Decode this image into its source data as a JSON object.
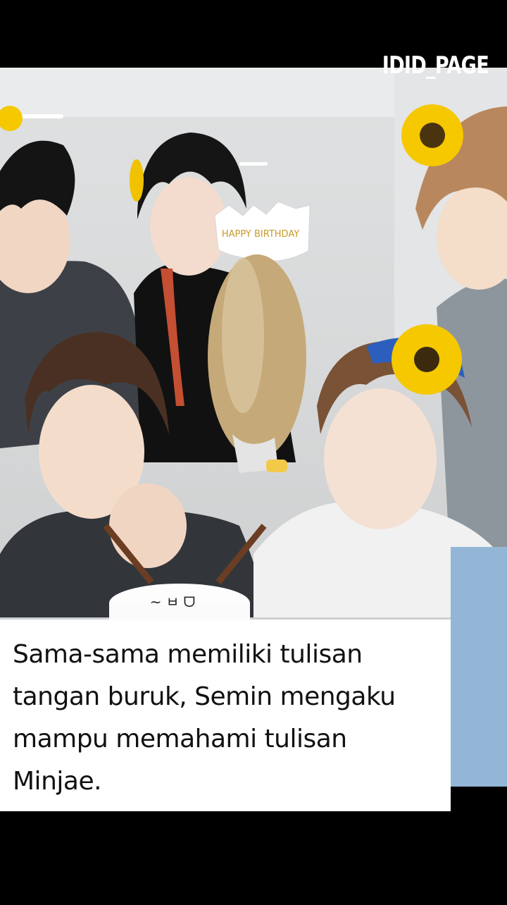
{
  "watermark": "IDID_PAGE",
  "caption": "Sama-sama memiliki tulisan tangan buruk, Semin mengaku mampu memahami tulisan Minjae.",
  "balloon_text": "HAPPY BIRTHDAY",
  "colors": {
    "background": "#000000",
    "caption_bg": "#ffffff",
    "caption_text": "#111111",
    "sunflower": "#f5c800"
  },
  "icons": [
    "sunflower-icon",
    "balloon-icon",
    "cake-icon"
  ]
}
